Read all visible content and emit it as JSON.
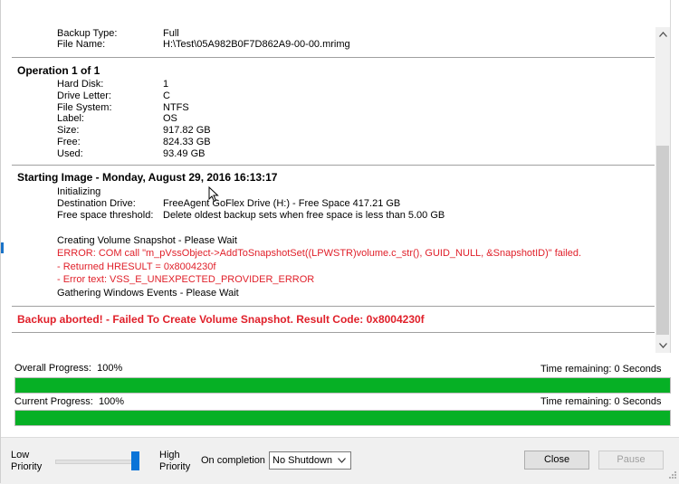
{
  "backup_info": {
    "backup_type_label": "Backup Type:",
    "backup_type": "Full",
    "file_name_label": "File Name:",
    "file_name": "H:\\Test\\05A982B0F7D862A9-00-00.mrimg"
  },
  "operation": {
    "heading": "Operation 1 of 1",
    "rows": [
      {
        "label": "Hard Disk:",
        "value": "1"
      },
      {
        "label": "Drive Letter:",
        "value": "C"
      },
      {
        "label": "File System:",
        "value": "NTFS"
      },
      {
        "label": "Label:",
        "value": "OS"
      },
      {
        "label": "Size:",
        "value": "917.82 GB"
      },
      {
        "label": "Free:",
        "value": "824.33 GB"
      },
      {
        "label": "Used:",
        "value": "93.49 GB"
      }
    ]
  },
  "starting": {
    "heading": "Starting Image - Monday, August 29, 2016 16:13:17",
    "initializing": "Initializing",
    "dest_label": "Destination Drive:",
    "dest_value": "FreeAgent GoFlex Drive (H:) - Free Space 417.21 GB",
    "threshold_label": "Free space threshold:",
    "threshold_value": "Delete oldest backup sets when free space is less than 5.00 GB",
    "snapshot": "Creating Volume Snapshot - Please Wait",
    "error_com": "ERROR: COM call \"m_pVssObject->AddToSnapshotSet((LPWSTR)volume.c_str(), GUID_NULL, &SnapshotID)\" failed.",
    "error_hresult": "- Returned HRESULT = 0x8004230f",
    "error_text": "- Error text: VSS_E_UNEXPECTED_PROVIDER_ERROR",
    "gathering": "Gathering Windows Events - Please Wait"
  },
  "abort_message": "Backup aborted! - Failed To Create Volume Snapshot. Result Code: 0x8004230f",
  "progress": {
    "overall_label": "Overall Progress:",
    "overall_value": "100%",
    "overall_fraction": 1.0,
    "overall_time": "Time remaining: 0 Seconds",
    "current_label": "Current Progress:",
    "current_value": "100%",
    "current_fraction": 1.0,
    "current_time": "Time remaining: 0 Seconds"
  },
  "bottom": {
    "low_priority_line1": "Low",
    "low_priority_line2": "Priority",
    "high_priority_line1": "High",
    "high_priority_line2": "Priority",
    "priority_level": 1.0,
    "on_completion_label": "On completion",
    "on_completion_value": "No Shutdown",
    "close_label": "Close",
    "pause_label": "Pause"
  },
  "icons": {
    "scroll_up": "chevron-up-icon",
    "scroll_down": "chevron-down-icon",
    "dropdown": "chevron-down-icon",
    "cursor": "cursor-icon",
    "grip": "resize-grip-icon"
  },
  "colors": {
    "error": "#e0202a",
    "progress_fill": "#06b025",
    "slider_accent": "#0a74d8"
  }
}
